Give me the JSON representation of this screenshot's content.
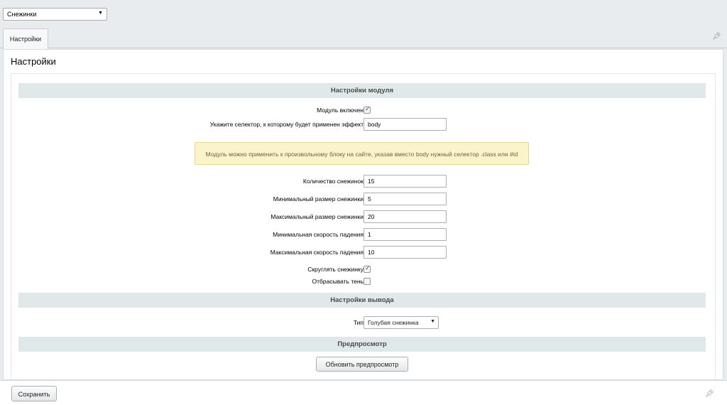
{
  "top_select": {
    "value": "Снежинки"
  },
  "tabs": [
    {
      "label": "Настройки"
    }
  ],
  "page_title": "Настройки",
  "sections": {
    "module": "Настройки модуля",
    "output": "Настройки вывода",
    "preview": "Предпросмотр"
  },
  "fields": {
    "enabled": {
      "label": "Модуль включен",
      "checked": true
    },
    "selector": {
      "label": "Укажите селектор, к которому будет применен эффект",
      "value": "body"
    },
    "notice": "Модуль можно применить к произвольному блоку на сайте, указав вместо body нужный селектор .class или #id",
    "count": {
      "label": "Количество снежинок",
      "value": "15"
    },
    "min_size": {
      "label": "Минимальный размер снежинки",
      "value": "5"
    },
    "max_size": {
      "label": "Максимальный размер снежинки",
      "value": "20"
    },
    "min_speed": {
      "label": "Минимальная скорость падения",
      "value": "1"
    },
    "max_speed": {
      "label": "Максимальная скорость падения",
      "value": "10"
    },
    "round": {
      "label": "Скруглять снежинку",
      "checked": true
    },
    "shadow": {
      "label": "Отбрасывать тень",
      "checked": false
    },
    "type": {
      "label": "Тип",
      "value": "Голубая снежинка"
    }
  },
  "buttons": {
    "refresh_preview": "Обновить предпросмотр",
    "save": "Сохранить"
  },
  "icons": {
    "pin": "pin-icon",
    "dropdown": "chevron-down-icon",
    "check": "checkmark-icon"
  }
}
